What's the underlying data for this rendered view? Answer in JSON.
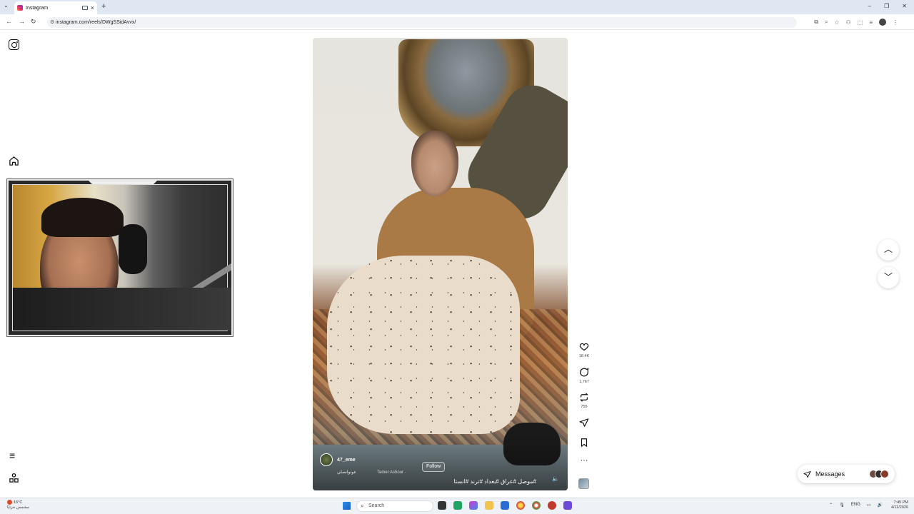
{
  "browser": {
    "tab_title": "Instagram",
    "url": "instagram.com/reels/DWgSSidAvvx/",
    "new_tab": "+",
    "close_tab": "×",
    "back": "←",
    "forward": "→",
    "reload": "↻",
    "window_controls": [
      "–",
      "❐",
      "✕"
    ]
  },
  "reel": {
    "username": "47_eme",
    "audio_label": "عونوانصلي",
    "audio_artist": "Tamer Ashour ·",
    "follow_label": "Follow",
    "caption": "#موصل #عراق #بغداد #ترند #انستا"
  },
  "actions": {
    "likes": "18.4K",
    "comments": "1,767",
    "reposts": "755"
  },
  "messages": {
    "label": "Messages"
  },
  "taskbar": {
    "weather_temp": "16°C",
    "weather_desc": "مشمس جزئيًا",
    "search_placeholder": "Search",
    "lang": "ENG",
    "time": "7:45 PM",
    "date": "4/11/2026"
  },
  "colors": {
    "accent": "#0095f6",
    "chrome_bg": "#dfe7f3",
    "taskbar_bg": "#eef1f6"
  }
}
